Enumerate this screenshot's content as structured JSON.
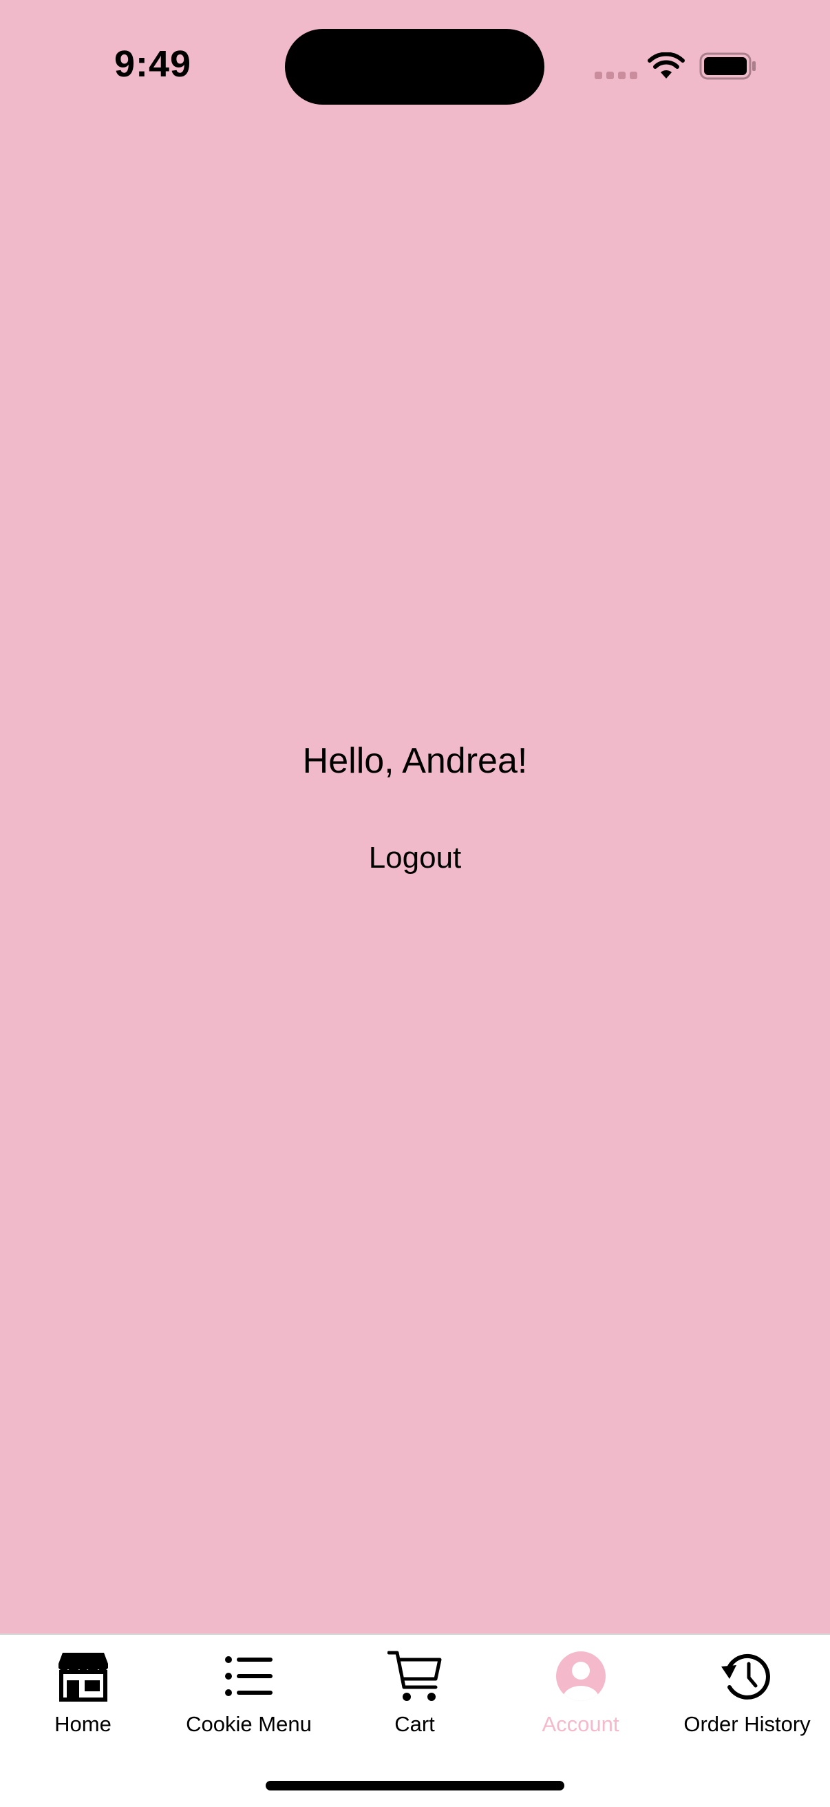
{
  "status_bar": {
    "time": "9:49"
  },
  "account": {
    "greeting": "Hello, Andrea!",
    "logout_label": "Logout"
  },
  "tab_bar": {
    "active_tab": "Account",
    "active_color": "#F4BACB",
    "inactive_color": "#000000",
    "tabs": [
      {
        "label": "Home",
        "icon": "storefront-icon"
      },
      {
        "label": "Cookie Menu",
        "icon": "list-icon"
      },
      {
        "label": "Cart",
        "icon": "cart-icon"
      },
      {
        "label": "Account",
        "icon": "person-circle-icon"
      },
      {
        "label": "Order History",
        "icon": "history-clock-icon"
      }
    ]
  },
  "colors": {
    "background": "#F1BACA",
    "tab_bar_background": "#FFFFFF"
  }
}
